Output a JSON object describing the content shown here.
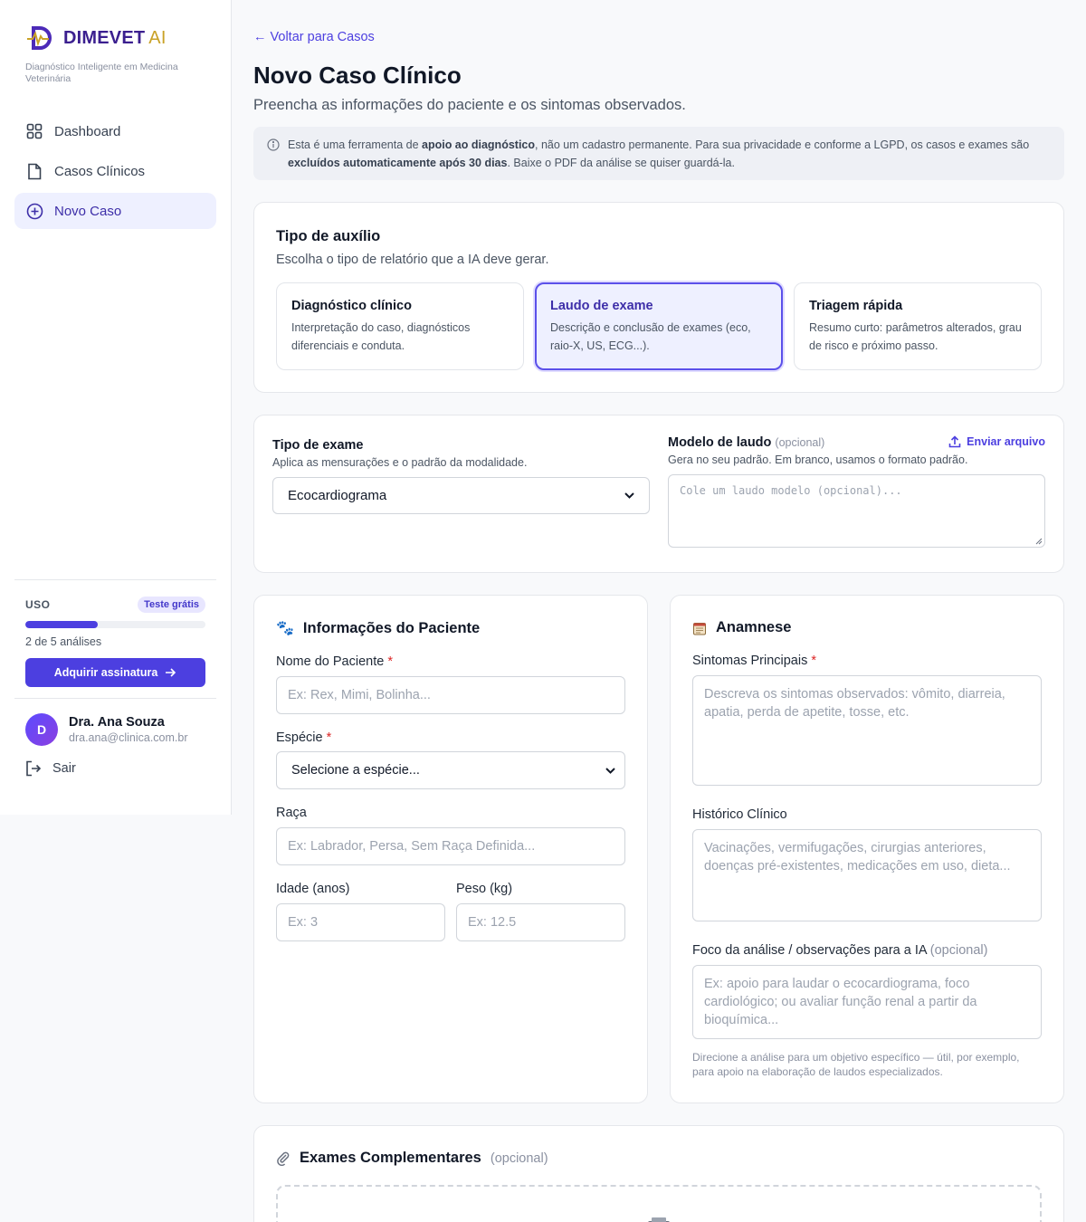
{
  "sidebar": {
    "brand": {
      "name": "DIMEVET",
      "suffix": "AI"
    },
    "tagline": "Diagnóstico Inteligente em Medicina Veterinária",
    "nav": [
      {
        "label": "Dashboard",
        "icon": "grid-icon"
      },
      {
        "label": "Casos Clínicos",
        "icon": "document-icon"
      },
      {
        "label": "Novo Caso",
        "icon": "plus-circle-icon",
        "active": true
      }
    ],
    "usage": {
      "label": "USO",
      "badge": "Teste grátis",
      "used": 2,
      "total": 5,
      "count_text": "2 de 5 análises",
      "button": "Adquirir assinatura"
    },
    "user": {
      "initial": "D",
      "name": "Dra. Ana Souza",
      "email": "dra.ana@clinica.com.br",
      "logout": "Sair"
    }
  },
  "main": {
    "back_link": "← Voltar para Casos",
    "title": "Novo Caso Clínico",
    "subtitle": "Preencha as informações do paciente e os sintomas observados.",
    "notice": {
      "p1": "Esta é uma ferramenta de ",
      "b1": "apoio ao diagnóstico",
      "p2": ", não um cadastro permanente. Para sua privacidade e conforme a LGPD, os casos e exames são ",
      "b2": "excluídos automaticamente após 30 dias",
      "p3": ". Baixe o PDF da análise se quiser guardá-la."
    },
    "aux": {
      "title": "Tipo de auxílio",
      "subtitle": "Escolha o tipo de relatório que a IA deve gerar.",
      "options": [
        {
          "title": "Diagnóstico clínico",
          "desc": "Interpretação do caso, diagnósticos diferenciais e conduta."
        },
        {
          "title": "Laudo de exame",
          "desc": "Descrição e conclusão de exames (eco, raio-X, US, ECG...).",
          "selected": true
        },
        {
          "title": "Triagem rápida",
          "desc": "Resumo curto: parâmetros alterados, grau de risco e próximo passo."
        }
      ]
    },
    "exam": {
      "type_label": "Tipo de exame",
      "type_help": "Aplica as mensurações e o padrão da modalidade.",
      "type_value": "Ecocardiograma",
      "model_label": "Modelo de laudo",
      "model_optional": "(opcional)",
      "model_help": "Gera no seu padrão. Em branco, usamos o formato padrão.",
      "upload": "Enviar arquivo",
      "model_placeholder": "Cole um laudo modelo (opcional)..."
    },
    "patient": {
      "title": "Informações do Paciente",
      "name_label": "Nome do Paciente",
      "name_placeholder": "Ex: Rex, Mimi, Bolinha...",
      "species_label": "Espécie",
      "species_value": "Selecione a espécie...",
      "breed_label": "Raça",
      "breed_placeholder": "Ex: Labrador, Persa, Sem Raça Definida...",
      "age_label": "Idade (anos)",
      "age_placeholder": "Ex: 3",
      "weight_label": "Peso (kg)",
      "weight_placeholder": "Ex: 12.5",
      "required_mark": "*"
    },
    "anamnese": {
      "title": "Anamnese",
      "symptoms_label": "Sintomas Principais",
      "symptoms_placeholder": "Descreva os sintomas observados: vômito, diarreia, apatia, perda de apetite, tosse, etc.",
      "history_label": "Histórico Clínico",
      "history_placeholder": "Vacinações, vermifugações, cirurgias anteriores, doenças pré-existentes, medicações em uso, dieta...",
      "focus_label": "Foco da análise / observações para a IA",
      "focus_optional": "(opcional)",
      "focus_placeholder": "Ex: apoio para laudar o ecocardiograma, foco cardiológico; ou avaliar função renal a partir da bioquímica...",
      "focus_help": "Direcione a análise para um objetivo específico — útil, por exemplo, para apoio na elaboração de laudos especializados."
    },
    "complement": {
      "title": "Exames Complementares",
      "optional": "(opcional)"
    }
  },
  "colors": {
    "accent": "#4c3fe0",
    "brand": "#3b1f8f",
    "brand_ai": "#c9a227",
    "required": "#dc2626"
  }
}
